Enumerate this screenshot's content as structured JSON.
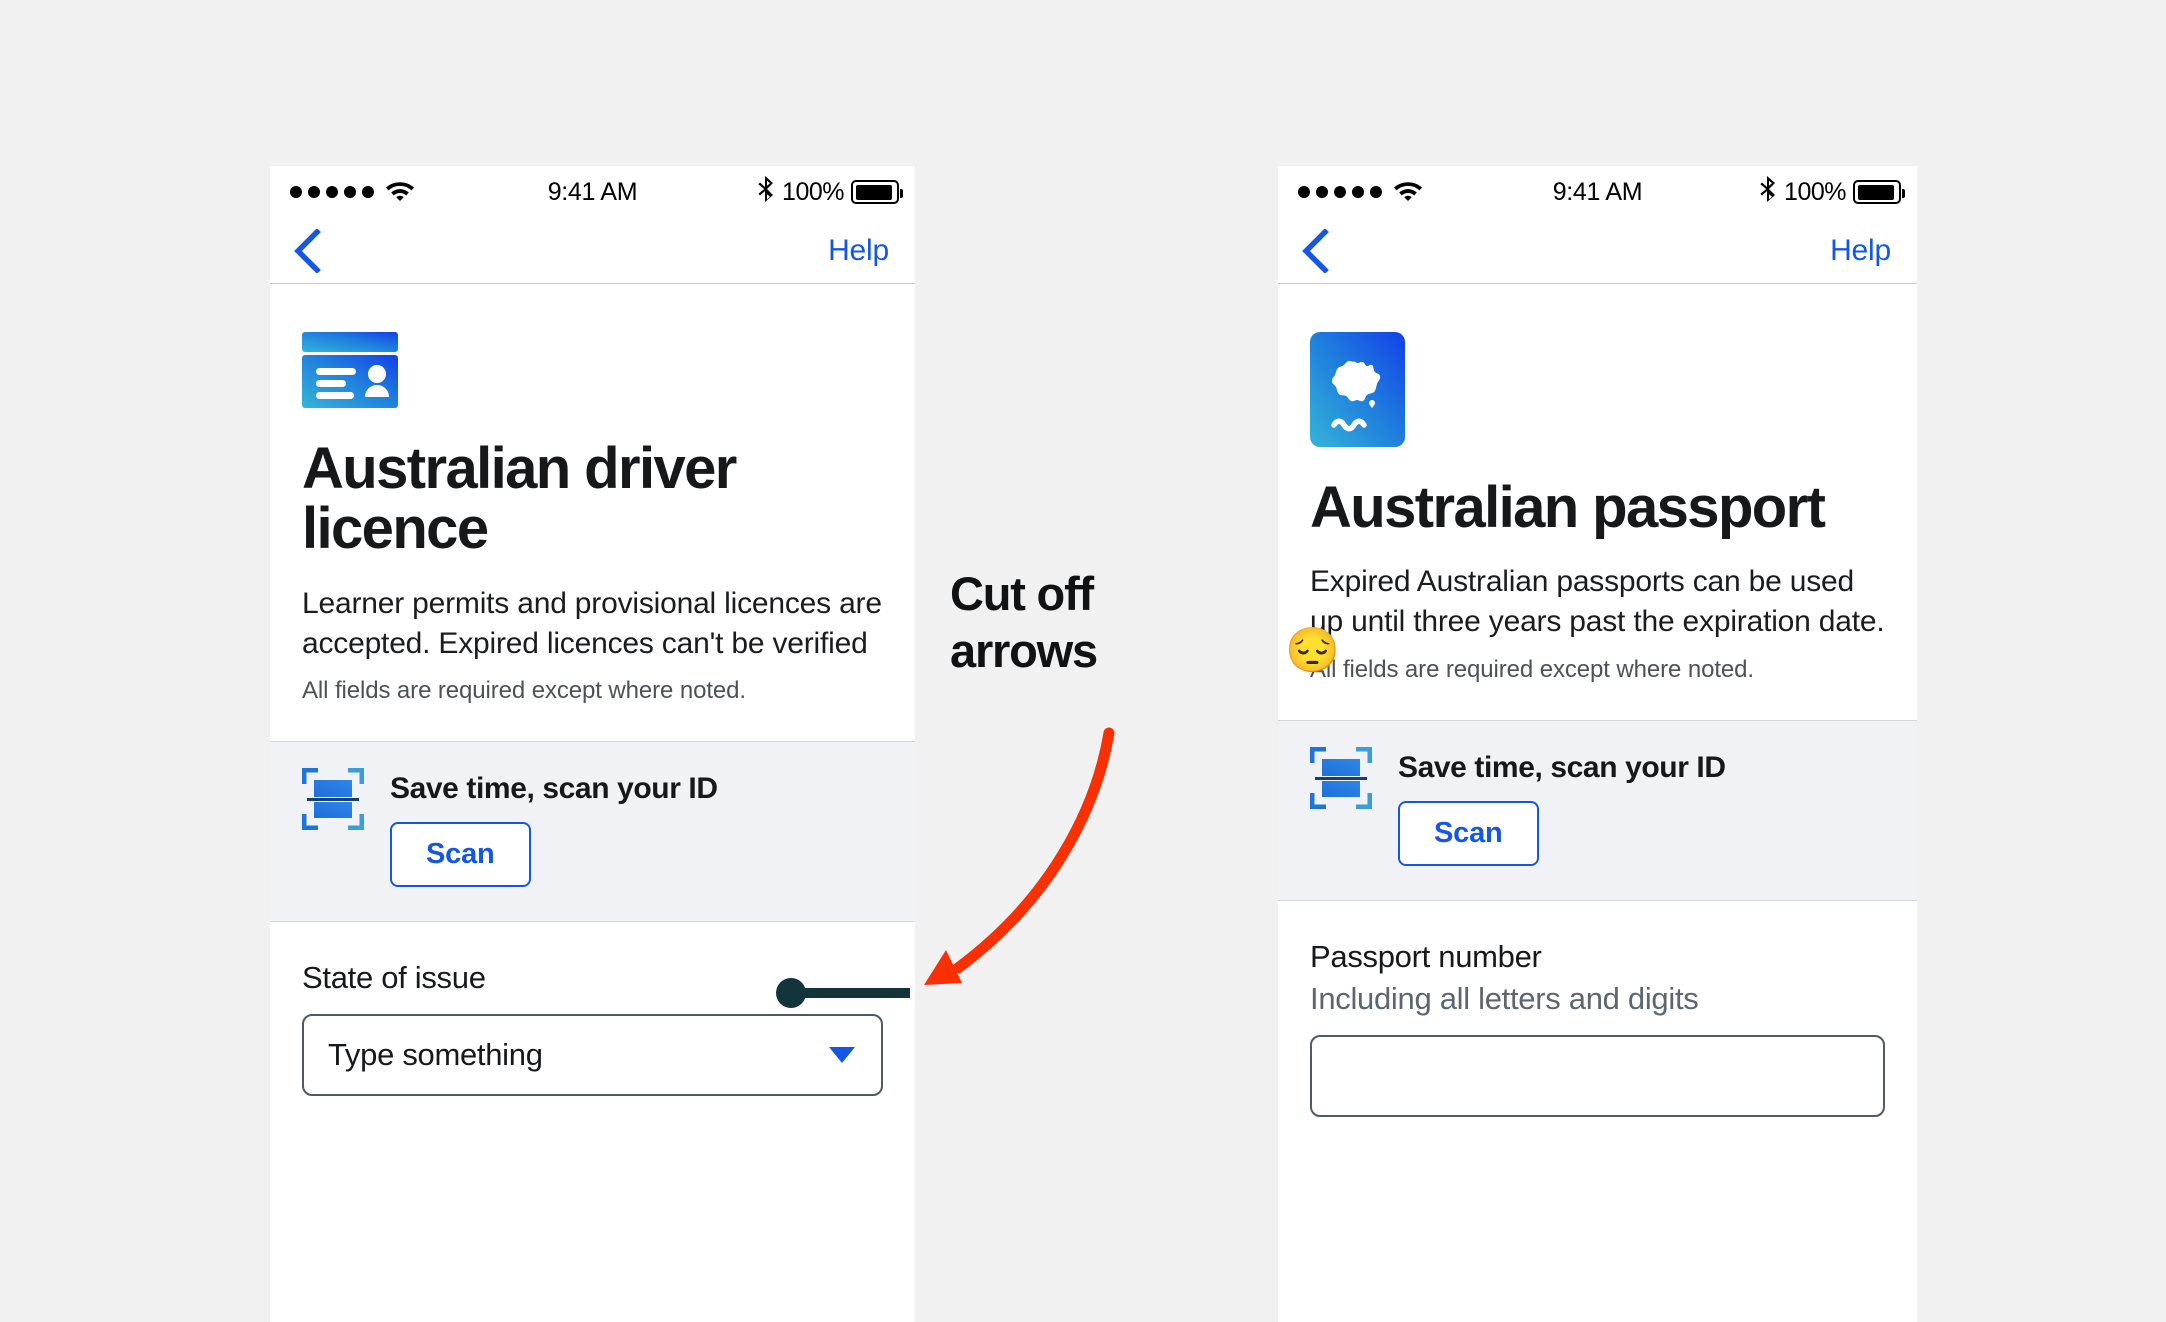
{
  "status_bar": {
    "signal_dots": 5,
    "wifi_icon": "wifi-icon",
    "time": "9:41 AM",
    "bluetooth_icon": "bluetooth-icon",
    "battery_percent": "100%"
  },
  "nav": {
    "back_icon": "back-chevron-icon",
    "help_label": "Help"
  },
  "annotation": {
    "text": "Cut off\narrows",
    "emoji": "😔",
    "arrow_color": "#fa3005",
    "callout_color": "#13343b"
  },
  "colors": {
    "page_background": "#f1f1f1",
    "card_background": "#ffffff",
    "scan_band_background": "#f0f2f5",
    "accent_blue": "#1457e5",
    "border_gray": "#4e5b62",
    "text_primary": "#16181a",
    "text_muted": "#4c5257"
  },
  "screens": [
    {
      "id": "driver-licence",
      "icon_name": "id-card-icon",
      "title": "Australian driver licence",
      "description": "Learner permits and provisional licences are accepted. Expired licences can't be verified",
      "note": "All fields are required except where noted.",
      "scan": {
        "icon_name": "scan-id-icon",
        "title": "Save time, scan your ID",
        "button_label": "Scan"
      },
      "field": {
        "type": "select",
        "label": "State of issue",
        "hint": "",
        "value": "Type something",
        "caret_icon": "chevron-down-icon"
      }
    },
    {
      "id": "passport",
      "icon_name": "australian-passport-icon",
      "title": "Australian passport",
      "description": "Expired Australian passports can be used up until three years past the expiration date.",
      "note": "All fields are required except where noted.",
      "scan": {
        "icon_name": "scan-id-icon",
        "title": "Save time, scan your ID",
        "button_label": "Scan"
      },
      "field": {
        "type": "text",
        "label": "Passport number",
        "hint": "Including all letters and digits",
        "value": "",
        "placeholder": ""
      }
    }
  ]
}
